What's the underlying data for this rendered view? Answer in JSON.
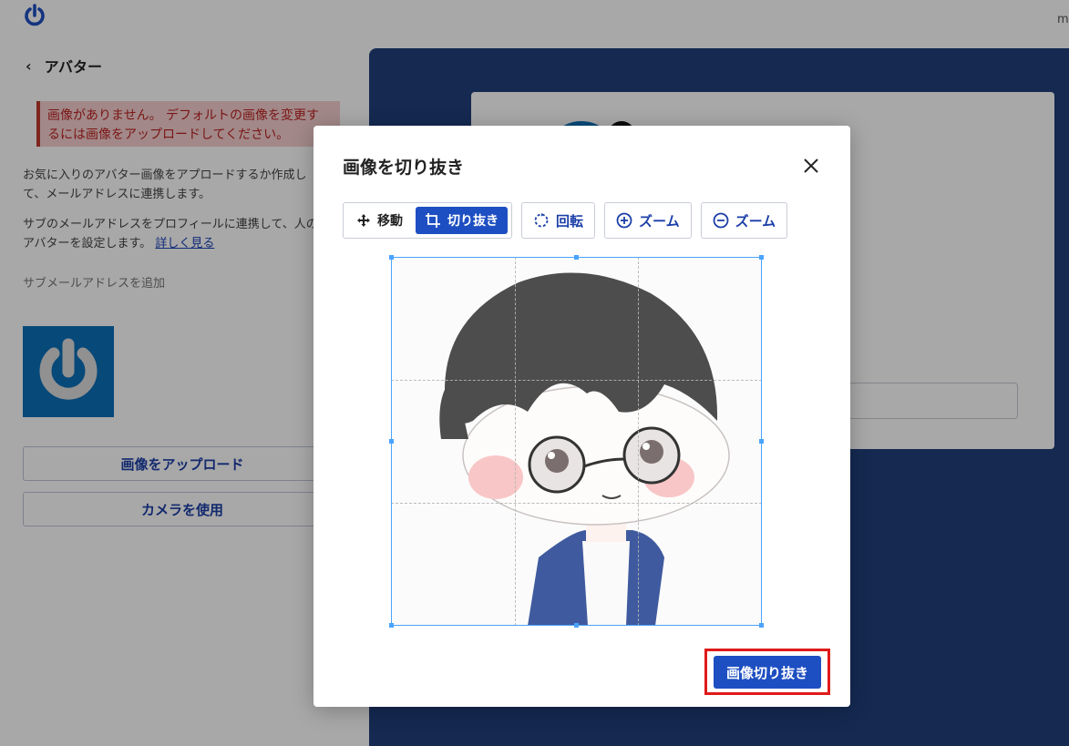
{
  "page": {
    "title": "アバター",
    "alert": "画像がありません。 デフォルトの画像を変更するには画像をアップロードしてください。",
    "desc1": "お気に入りのアバター画像をアプロードするか作成して、メールアドレスに連携します。",
    "desc2": "サブのメールアドレスをプロフィールに連携して、人のアバターを設定します。",
    "learn_more": "詳しく見る",
    "add_sub_email": "サブメールアドレスを追加",
    "upload_button": "画像をアップロード",
    "camera_button": "カメラを使用",
    "account_fragment": "m"
  },
  "modal": {
    "title": "画像を切り抜き",
    "tools": {
      "move": "移動",
      "crop": "切り抜き",
      "rotate": "回転",
      "zoom_in": "ズーム",
      "zoom_out": "ズーム"
    },
    "active_tool": "crop",
    "submit": "画像切り抜き"
  },
  "colors": {
    "primary": "#1e4fc2",
    "panel": "#213f7b",
    "crop_border": "#4aa3ff",
    "highlight": "#e01a1a",
    "alert_bg": "#f6cfcf"
  }
}
